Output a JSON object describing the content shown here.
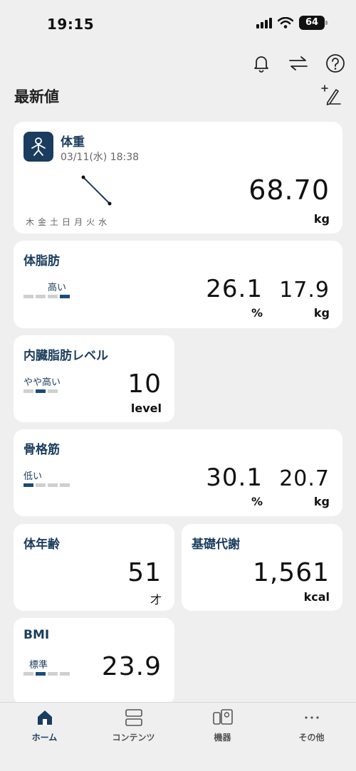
{
  "status_bar": {
    "time": "19:15",
    "battery": "64"
  },
  "header": {
    "section_title": "最新値"
  },
  "weight": {
    "title": "体重",
    "datetime": "03/11(水) 18:38",
    "value": "68.70",
    "unit": "kg",
    "weekdays": [
      "木",
      "金",
      "土",
      "日",
      "月",
      "火",
      "水"
    ]
  },
  "body_fat": {
    "title": "体脂肪",
    "level_label": "高い",
    "level_index": 4,
    "level_count": 4,
    "percent": "26.1",
    "percent_unit": "%",
    "mass": "17.9",
    "mass_unit": "kg"
  },
  "visceral_fat": {
    "title": "内臓脂肪レベル",
    "level_label": "やや高い",
    "level_index": 2,
    "level_count": 3,
    "value": "10",
    "unit": "level"
  },
  "skeletal_muscle": {
    "title": "骨格筋",
    "level_label": "低い",
    "level_index": 1,
    "level_count": 4,
    "percent": "30.1",
    "percent_unit": "%",
    "mass": "20.7",
    "mass_unit": "kg"
  },
  "body_age": {
    "title": "体年齢",
    "value": "51",
    "unit": "才"
  },
  "bmr": {
    "title": "基礎代謝",
    "value": "1,561",
    "unit": "kcal"
  },
  "bmi": {
    "title": "BMI",
    "level_label": "標準",
    "level_index": 2,
    "level_count": 4,
    "value": "23.9"
  },
  "nav": {
    "items": [
      {
        "label": "ホーム"
      },
      {
        "label": "コンテンツ"
      },
      {
        "label": "機器"
      },
      {
        "label": "その他"
      }
    ]
  },
  "colors": {
    "accent": "#1a3c5e",
    "bar_on": "#1a4a7a",
    "bar_off": "#cfcfcf",
    "background": "#efefef"
  }
}
